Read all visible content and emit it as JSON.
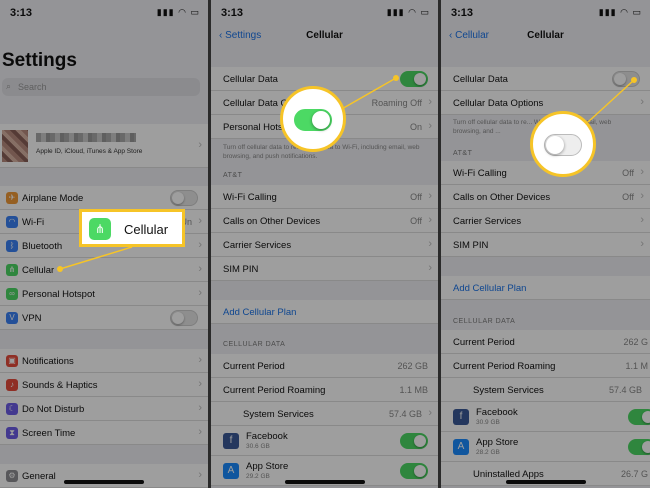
{
  "status_time": "3:13",
  "status_icons": "▮▮▮ ◠ ▭",
  "colors": {
    "accent": "#1a73e8",
    "toggle_on": "#4cd964",
    "callout": "#f6c427"
  },
  "screen1": {
    "title": "Settings",
    "search_placeholder": "Search",
    "profile_sub": "Apple ID, iCloud, iTunes & App Store",
    "rows": [
      {
        "label": "Airplane Mode",
        "icon": "airplane-icon",
        "color": "#f19a37",
        "glyph": "✈"
      },
      {
        "label": "Wi-Fi",
        "icon": "wifi-icon",
        "color": "#3b82f6",
        "glyph": "◠"
      },
      {
        "label": "Bluetooth",
        "icon": "bluetooth-icon",
        "color": "#3b82f6",
        "glyph": "ᛒ"
      },
      {
        "label": "Cellular",
        "icon": "cellular-icon",
        "color": "#4cd964",
        "glyph": "⋔"
      },
      {
        "label": "Personal Hotspot",
        "icon": "hotspot-icon",
        "color": "#4cd964",
        "glyph": "∞"
      },
      {
        "label": "VPN",
        "icon": "vpn-icon",
        "color": "#3b82f6",
        "glyph": "V"
      },
      {
        "label": "Notifications",
        "icon": "notifications-icon",
        "color": "#e74c3c",
        "glyph": "▣"
      },
      {
        "label": "Sounds & Haptics",
        "icon": "sounds-icon",
        "color": "#e74c3c",
        "glyph": "♪"
      },
      {
        "label": "Do Not Disturb",
        "icon": "moon-icon",
        "color": "#6c5ce7",
        "glyph": "☾"
      },
      {
        "label": "Screen Time",
        "icon": "hourglass-icon",
        "color": "#6c5ce7",
        "glyph": "⧗"
      },
      {
        "label": "General",
        "icon": "gear-icon",
        "color": "#8e8e93",
        "glyph": "⚙"
      }
    ],
    "wifi_value": "Un",
    "callout_label": "Cellular"
  },
  "screen2": {
    "back": "Settings",
    "title": "Cellular",
    "cellular_data": "Cellular Data",
    "cellular_data_options": "Cellular Data O",
    "roaming_value": "Roaming Off",
    "personal_hotspot": "Personal Hots",
    "hotspot_value": "On",
    "note": "Turn off cellular data to restrict all data to Wi-Fi, including email, web browsing, and push notifications.",
    "carrier_header": "AT&T",
    "wifi_calling": "Wi-Fi Calling",
    "wifi_calling_value": "Off",
    "calls_other": "Calls on Other Devices",
    "calls_other_value": "Off",
    "carrier_services": "Carrier Services",
    "sim_pin": "SIM PIN",
    "add_plan": "Add Cellular Plan",
    "data_header": "CELLULAR DATA",
    "current_period": "Current Period",
    "current_period_value": "262 GB",
    "current_roaming": "Current Period Roaming",
    "current_roaming_value": "1.1 MB",
    "system_services": "System Services",
    "system_services_value": "57.4 GB",
    "facebook": "Facebook",
    "facebook_size": "30.6 GB",
    "appstore": "App Store",
    "appstore_size": "29.2 GB"
  },
  "screen3": {
    "back": "Cellular",
    "title": "Cellular",
    "cellular_data": "Cellular Data",
    "cellular_data_options": "Cellular Data Options",
    "note": "Turn off cellular data to re... Wi-Fi, including email, web browsing, and ...",
    "carrier_header": "AT&T",
    "wifi_calling": "Wi-Fi Calling",
    "wifi_calling_value": "Off",
    "calls_other": "Calls on Other Devices",
    "calls_other_value": "Off",
    "carrier_services": "Carrier Services",
    "sim_pin": "SIM PIN",
    "add_plan": "Add Cellular Plan",
    "data_header": "CELLULAR DATA",
    "current_period": "Current Period",
    "current_period_value": "262 G",
    "current_roaming": "Current Period Roaming",
    "current_roaming_value": "1.1 M",
    "system_services": "System Services",
    "system_services_value": "57.4 GB",
    "facebook": "Facebook",
    "facebook_size": "30.9 GB",
    "appstore": "App Store",
    "appstore_size": "28.2 GB",
    "uninstalled": "Uninstalled Apps",
    "uninstalled_value": "26.7 G"
  }
}
